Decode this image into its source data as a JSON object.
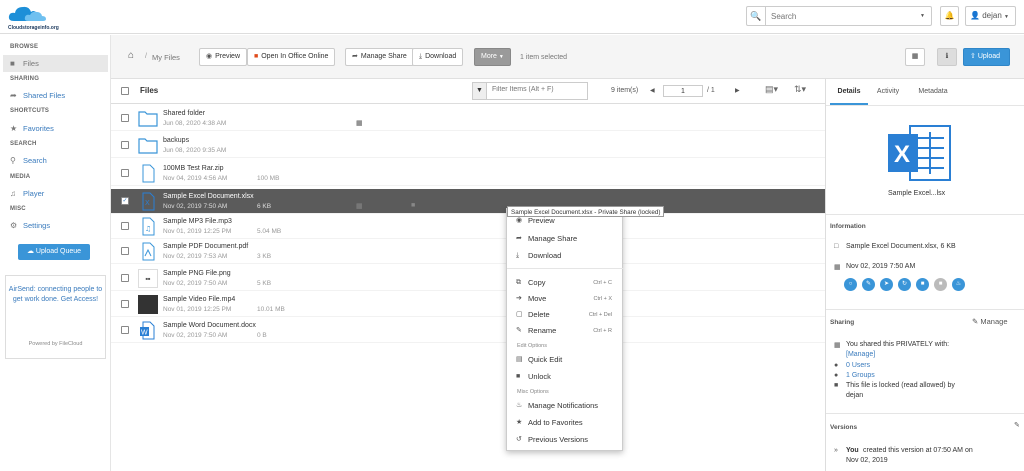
{
  "app": {
    "logo_text": "Cloudstorageinfo.org",
    "user": "dejan",
    "search_placeholder": "Search"
  },
  "sidebar": {
    "sections": [
      {
        "title": "BROWSE",
        "items": [
          {
            "label": "Files",
            "icon": "folder-icon",
            "active": true
          }
        ]
      },
      {
        "title": "SHARING",
        "items": [
          {
            "label": "Shared Files",
            "icon": "share-icon"
          }
        ]
      },
      {
        "title": "SHORTCUTS",
        "items": [
          {
            "label": "Favorites",
            "icon": "star-icon"
          }
        ]
      },
      {
        "title": "SEARCH",
        "items": [
          {
            "label": "Search",
            "icon": "search-icon"
          }
        ]
      },
      {
        "title": "MEDIA",
        "items": [
          {
            "label": "Player",
            "icon": "music-icon"
          }
        ]
      },
      {
        "title": "MISC",
        "items": [
          {
            "label": "Settings",
            "icon": "gear-icon"
          }
        ]
      }
    ],
    "upload_queue": "Upload Queue",
    "airsend": "AirSend: connecting people to get work done. Get Access!",
    "powered_by": "Powered by FileCloud"
  },
  "toolbar": {
    "breadcrumb": "My Files",
    "preview": "Preview",
    "open_office": "Open In Office Online",
    "manage_share": "Manage Share",
    "download": "Download",
    "more": "More",
    "selected": "1 item selected",
    "upload": "Upload"
  },
  "list": {
    "header": "Files",
    "filter_placeholder": "Filter Items (Alt + F)",
    "count": "9 item(s)",
    "page": "1",
    "total_pages": "/ 1",
    "items": [
      {
        "name": "Shared folder",
        "date": "Jun 08, 2020 4:38 AM",
        "size": "",
        "type": "folder"
      },
      {
        "name": "backups",
        "date": "Jun 08, 2020 9:35 AM",
        "size": "",
        "type": "folder"
      },
      {
        "name": "100MB Test Rar.zip",
        "date": "Nov 04, 2019 4:56 AM",
        "size": "100 MB",
        "type": "file"
      },
      {
        "name": "Sample Excel Document.xlsx",
        "date": "Nov 02, 2019 7:50 AM",
        "size": "6 KB",
        "type": "excel",
        "selected": true
      },
      {
        "name": "Sample MP3 File.mp3",
        "date": "Nov 01, 2019 12:25 PM",
        "size": "5.04 MB",
        "type": "audio"
      },
      {
        "name": "Sample PDF Document.pdf",
        "date": "Nov 02, 2019 7:53 AM",
        "size": "3 KB",
        "type": "pdf"
      },
      {
        "name": "Sample PNG File.png",
        "date": "Nov 02, 2019 7:50 AM",
        "size": "5 KB",
        "type": "image"
      },
      {
        "name": "Sample Video File.mp4",
        "date": "Nov 01, 2019 12:25 PM",
        "size": "10.01 MB",
        "type": "video"
      },
      {
        "name": "Sample Word Document.docx",
        "date": "Nov 02, 2019 7:50 AM",
        "size": "0 B",
        "type": "word"
      }
    ]
  },
  "tooltip": "Sample Excel Document.xlsx - Private Share (locked)",
  "context_menu": {
    "preview": "Preview",
    "manage_share": "Manage Share",
    "download": "Download",
    "copy": "Copy",
    "copy_sc": "Ctrl + C",
    "move": "Move",
    "move_sc": "Ctrl + X",
    "delete": "Delete",
    "delete_sc": "Ctrl + Del",
    "rename": "Rename",
    "rename_sc": "Ctrl + R",
    "edit_options": "Edit Options",
    "quick_edit": "Quick Edit",
    "unlock": "Unlock",
    "misc_options": "Misc Options",
    "manage_notifications": "Manage Notifications",
    "add_favorites": "Add to Favorites",
    "previous_versions": "Previous Versions"
  },
  "details": {
    "tabs": [
      "Details",
      "Activity",
      "Metadata"
    ],
    "file_short": "Sample Excel...lsx",
    "info_header": "Information",
    "file_info": "Sample Excel Document.xlsx, 6 KB",
    "file_date": "Nov 02, 2019 7:50 AM",
    "sharing_header": "Sharing",
    "manage": "Manage",
    "shared_text": "You shared this PRIVATELY with:",
    "manage_link": "[Manage]",
    "users": "0 Users",
    "groups": "1 Groups",
    "locked": "This file is locked (read allowed) by",
    "locked_by": "dejan",
    "versions_header": "Versions",
    "version_user": "You",
    "version_text": "created this version at 07:50 AM on",
    "version_date": "Nov 02, 2019"
  },
  "colors": {
    "accent": "#3a95d8",
    "selected_row": "#5b5b5b",
    "excel": "#2a7fd4"
  }
}
